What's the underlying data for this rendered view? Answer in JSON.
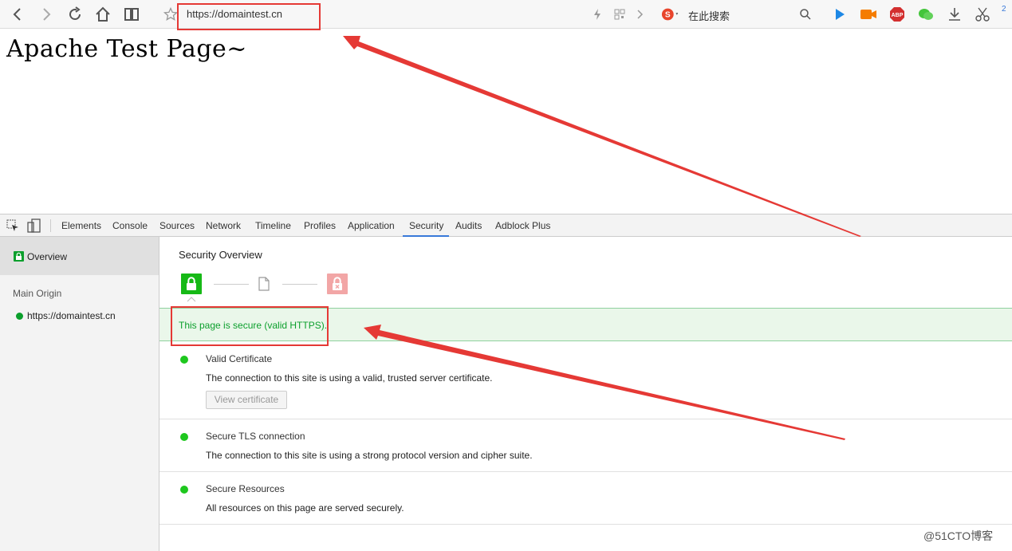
{
  "browser": {
    "url": "https://domaintest.cn",
    "search_engine_label": "在此搜索",
    "page_counter": "2"
  },
  "page": {
    "heading": "Apache Test Page~"
  },
  "devtools": {
    "tabs": [
      "Elements",
      "Console",
      "Sources",
      "Network",
      "Timeline",
      "Profiles",
      "Application",
      "Security",
      "Audits",
      "Adblock Plus"
    ],
    "active_tab": "Security",
    "sidebar": {
      "overview_label": "Overview",
      "main_origin_label": "Main Origin",
      "origin": "https://domaintest.cn"
    },
    "security": {
      "title": "Security Overview",
      "summary": "This page is secure (valid HTTPS).",
      "items": [
        {
          "title": "Valid Certificate",
          "description": "The connection to this site is using a valid, trusted server certificate.",
          "button": "View certificate"
        },
        {
          "title": "Secure TLS connection",
          "description": "The connection to this site is using a strong protocol version and cipher suite."
        },
        {
          "title": "Secure Resources",
          "description": "All resources on this page are served securely."
        }
      ]
    }
  },
  "watermark": "@51CTO博客",
  "colors": {
    "secure_green": "#0b9f2c",
    "annotation_red": "#e53935",
    "active_tab_blue": "#3879d9"
  }
}
